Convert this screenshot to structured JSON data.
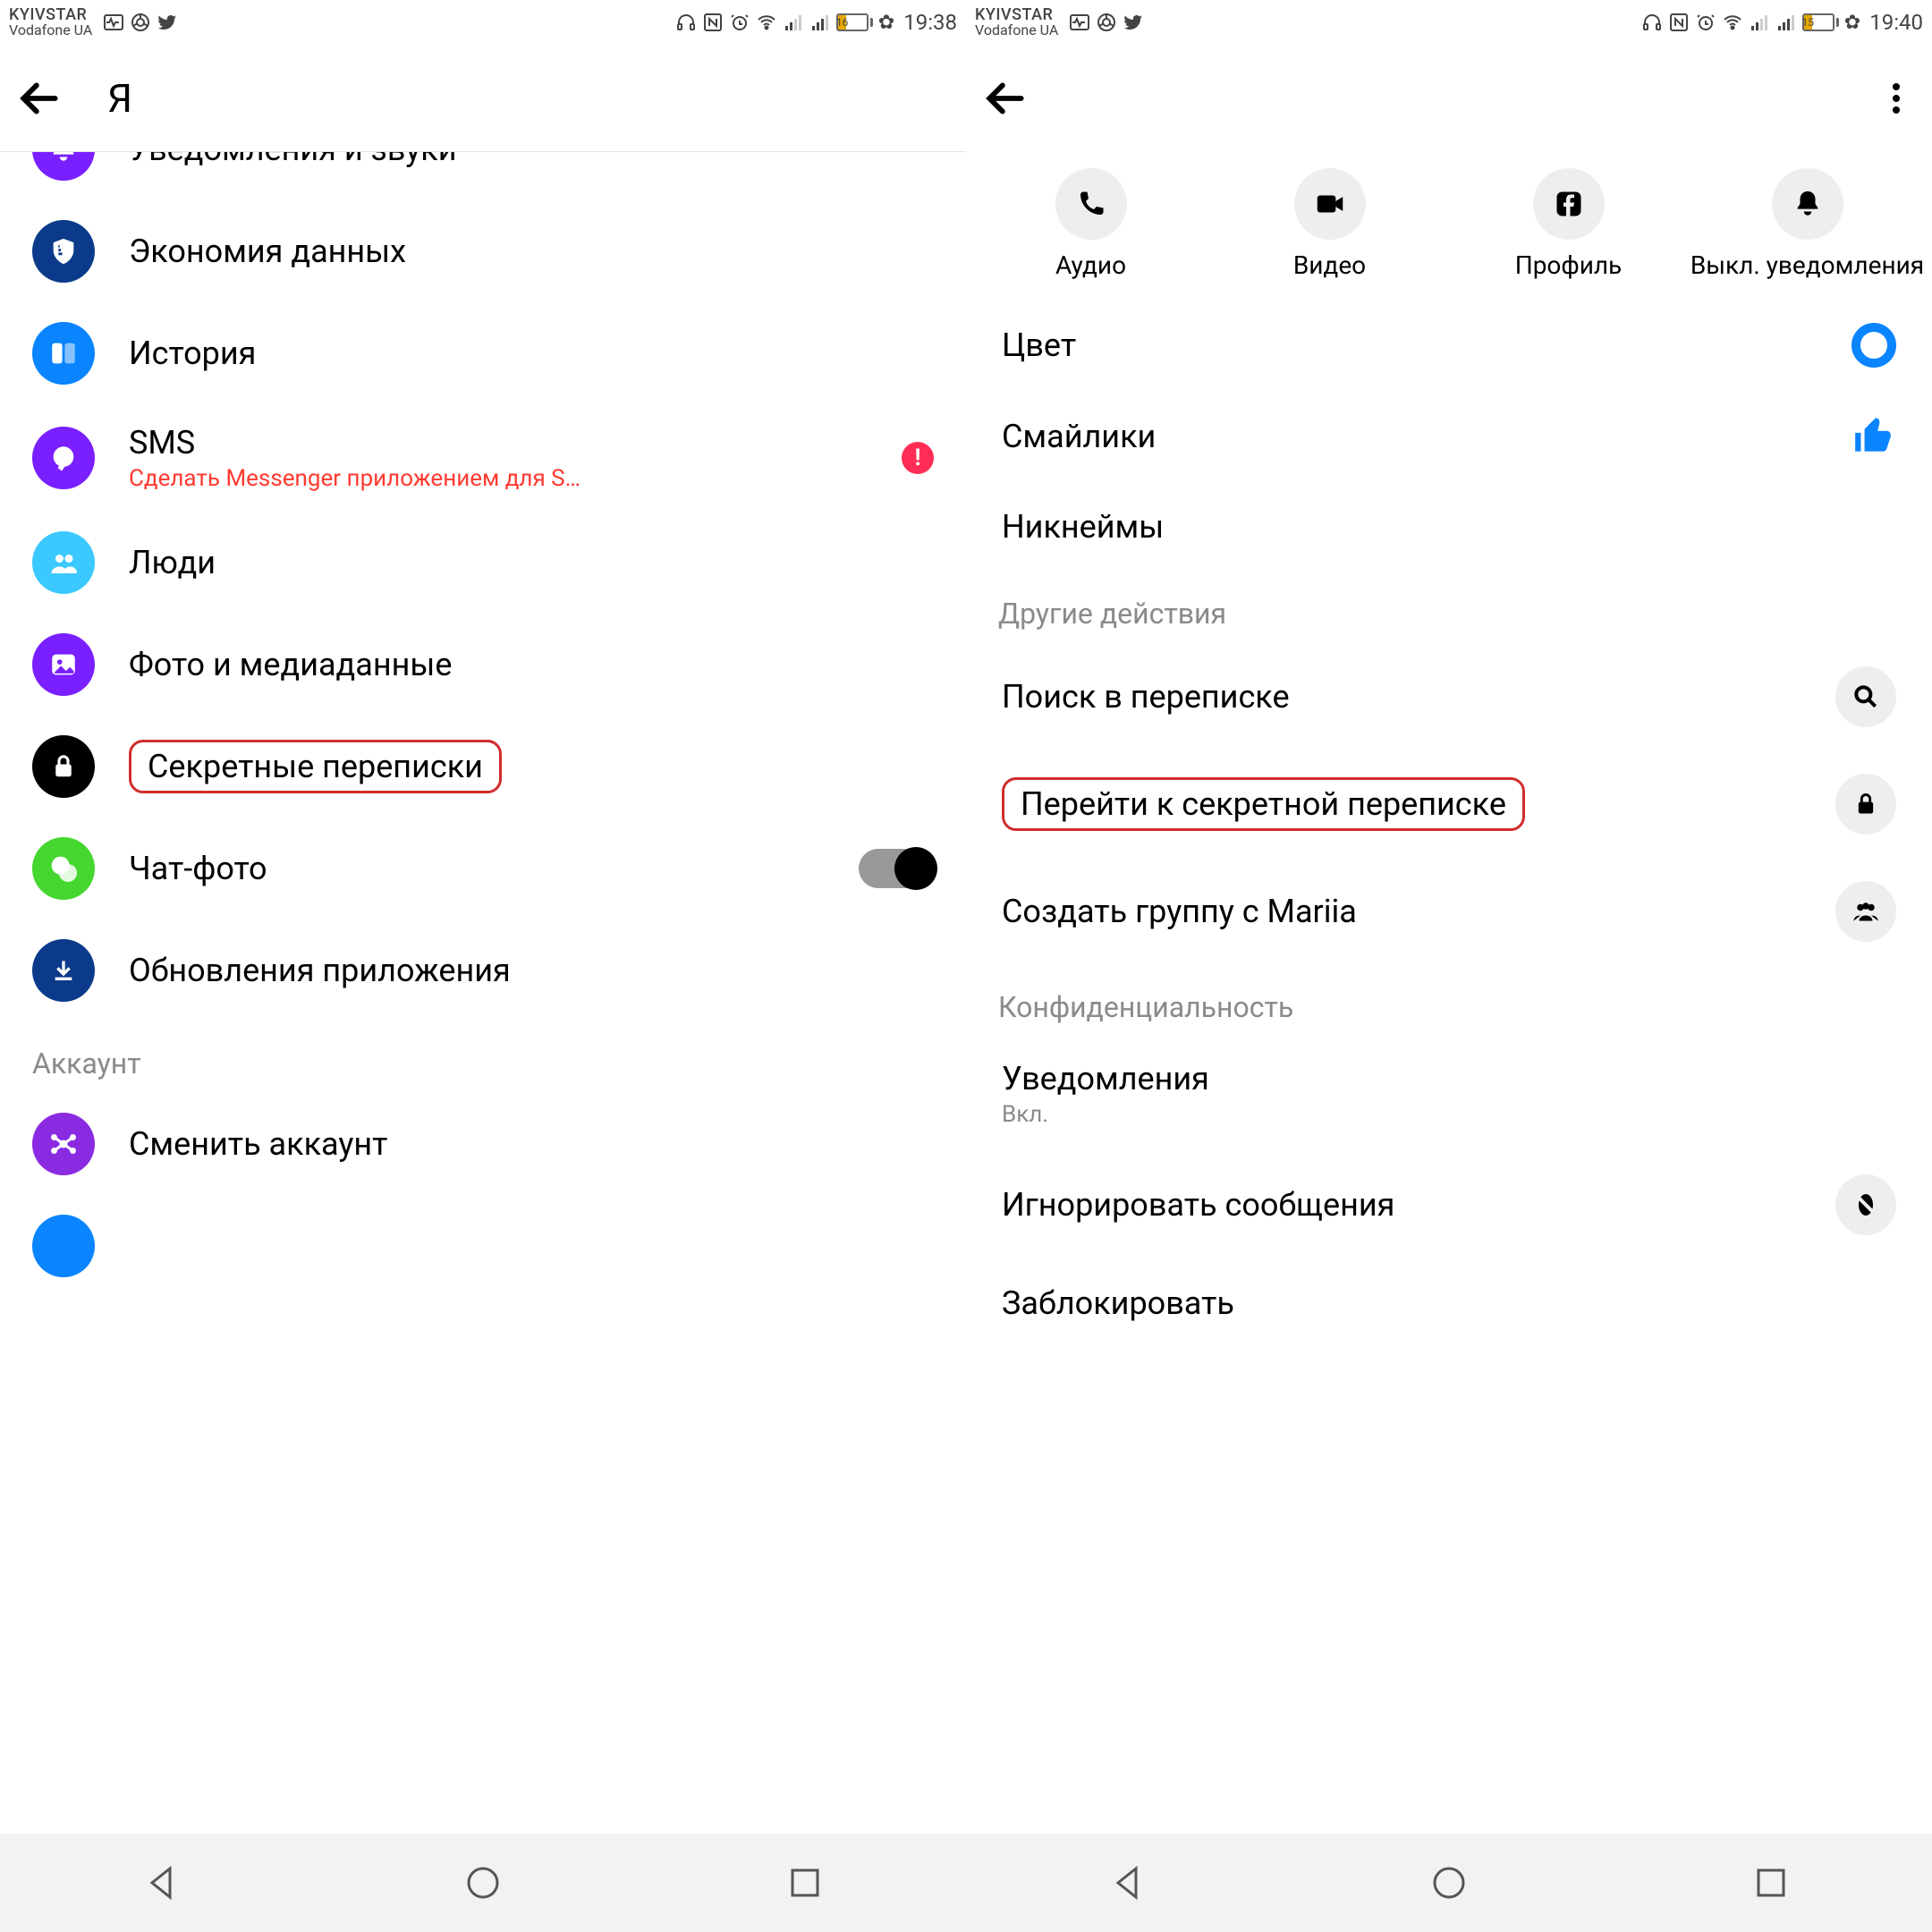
{
  "left": {
    "status": {
      "carrier1": "KYIVSTAR",
      "carrier2": "Vodafone UA",
      "battery": "16",
      "time": "19:38"
    },
    "nav": {
      "title": "Я"
    },
    "items": [
      {
        "icon": "bell",
        "label": "Уведомления и звуки",
        "bg": "bg-purple"
      },
      {
        "icon": "shield",
        "label": "Экономия данных",
        "bg": "bg-darkblue"
      },
      {
        "icon": "pane",
        "label": "История",
        "bg": "bg-blue"
      },
      {
        "icon": "chat",
        "label": "SMS",
        "bg": "bg-purple",
        "sub": "Сделать Messenger приложением для S…",
        "alert": true
      },
      {
        "icon": "people",
        "label": "Люди",
        "bg": "bg-sky"
      },
      {
        "icon": "image",
        "label": "Фото и медиаданные",
        "bg": "bg-purple"
      },
      {
        "icon": "lock",
        "label": "Секретные переписки",
        "bg": "bg-black",
        "highlight": true
      },
      {
        "icon": "double",
        "label": "Чат-фото",
        "bg": "bg-green",
        "toggle": true
      },
      {
        "icon": "download",
        "label": "Обновления приложения",
        "bg": "bg-darkblue"
      }
    ],
    "section": "Аккаунт",
    "account_items": [
      {
        "icon": "switch",
        "label": "Сменить аккаунт",
        "bg": "bg-purple2"
      }
    ]
  },
  "right": {
    "status": {
      "carrier1": "KYIVSTAR",
      "carrier2": "Vodafone UA",
      "battery": "15",
      "time": "19:40"
    },
    "actions": [
      {
        "icon": "phone",
        "label": "Аудио"
      },
      {
        "icon": "video",
        "label": "Видео"
      },
      {
        "icon": "fb",
        "label": "Профиль"
      },
      {
        "icon": "bell",
        "label": "Выкл. уведомления"
      }
    ],
    "rows1": [
      {
        "label": "Цвет",
        "trail": "color"
      },
      {
        "label": "Смайлики",
        "trail": "thumb"
      },
      {
        "label": "Никнеймы"
      }
    ],
    "section1": "Другие действия",
    "rows2": [
      {
        "label": "Поиск в переписке",
        "icon": "search"
      },
      {
        "label": "Перейти к секретной переписке",
        "icon": "lock",
        "highlight": true
      },
      {
        "label": "Создать группу с Mariia",
        "icon": "group"
      }
    ],
    "section2": "Конфиденциальность",
    "rows3": [
      {
        "label": "Уведомления",
        "sub": "Вкл."
      },
      {
        "label": "Игнорировать сообщения",
        "icon": "block"
      },
      {
        "label": "Заблокировать"
      }
    ]
  }
}
